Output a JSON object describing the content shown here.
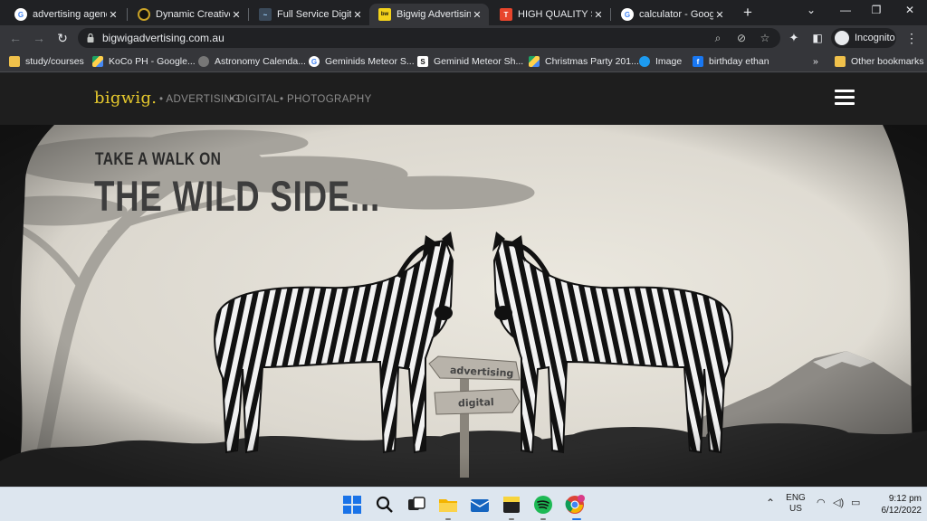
{
  "browser": {
    "tabs": [
      {
        "label": "advertising agency",
        "favicon": "google-icon",
        "active": false
      },
      {
        "label": "Dynamic Creative",
        "favicon": "dynamic-creative-icon",
        "active": false
      },
      {
        "label": "Full Service Digital",
        "favicon": "agency-icon",
        "active": false
      },
      {
        "label": "Bigwig Advertising",
        "favicon": "bigwig-icon",
        "active": true
      },
      {
        "label": "HIGH QUALITY Syn",
        "favicon": "t-icon",
        "active": false
      },
      {
        "label": "calculator - Google",
        "favicon": "google-icon",
        "active": false
      }
    ],
    "new_tab_symbol": "+",
    "url": "bigwigadvertising.com.au",
    "profile_label": "Incognito"
  },
  "bookmarks": {
    "items": [
      {
        "label": "study/courses",
        "icon": "folder-icon"
      },
      {
        "label": "KoCo PH - Google...",
        "icon": "drive-icon"
      },
      {
        "label": "Astronomy Calenda...",
        "icon": "globe-icon"
      },
      {
        "label": "Geminids Meteor S...",
        "icon": "google-icon"
      },
      {
        "label": "Geminid Meteor Sh...",
        "icon": "s-icon"
      },
      {
        "label": "Christmas Party 201...",
        "icon": "drive-icon"
      },
      {
        "label": "Image",
        "icon": "twitter-icon"
      },
      {
        "label": "birthday ethan",
        "icon": "facebook-icon"
      }
    ],
    "overflow": "»",
    "other_label": "Other bookmarks"
  },
  "site": {
    "logo": "bigwig.",
    "nav": [
      "• ADVERTISING",
      "• DIGITAL",
      "• PHOTOGRAPHY"
    ],
    "hero_line1": "TAKE A WALK ON",
    "hero_line2": "THE WILD SIDE...",
    "sign_top": "advertising",
    "sign_bottom": "digital"
  },
  "taskbar": {
    "lang_line1": "ENG",
    "lang_line2": "US",
    "time": "9:12 pm",
    "date": "6/12/2022"
  },
  "colors": {
    "logo": "#e6c92d",
    "chrome_dark": "#202124",
    "chrome_toolbar": "#35363a"
  }
}
